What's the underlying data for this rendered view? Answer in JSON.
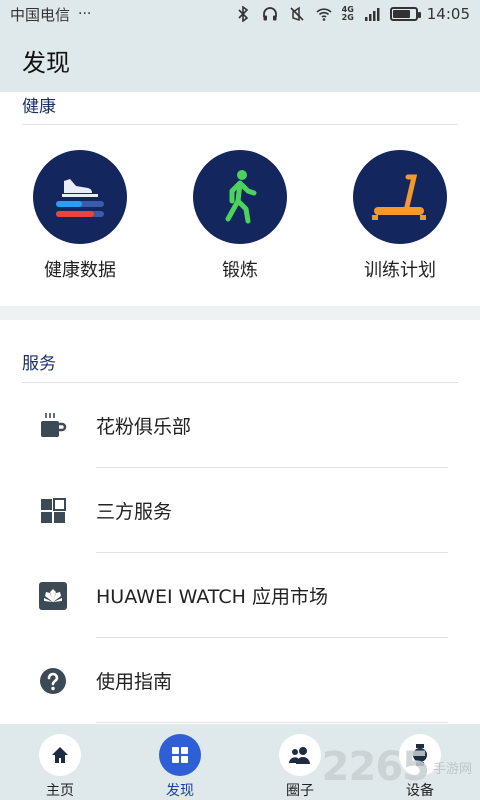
{
  "status_bar": {
    "carrier": "中国电信",
    "more": "···",
    "network_top": "4G",
    "network_bottom": "2G",
    "time": "14:05",
    "battery_level": 0.7
  },
  "app_bar": {
    "title": "发现"
  },
  "health": {
    "title": "健康",
    "items": [
      {
        "label": "健康数据",
        "icon": "shoe-progress-icon"
      },
      {
        "label": "锻炼",
        "icon": "walking-person-icon"
      },
      {
        "label": "训练计划",
        "icon": "treadmill-icon"
      }
    ]
  },
  "services": {
    "title": "服务",
    "items": [
      {
        "label": "花粉俱乐部",
        "icon": "coffee-cup-icon"
      },
      {
        "label": "三方服务",
        "icon": "grid-squares-icon"
      },
      {
        "label": "HUAWEI WATCH 应用市场",
        "icon": "huawei-logo-icon"
      },
      {
        "label": "使用指南",
        "icon": "question-icon"
      }
    ]
  },
  "tabs": [
    {
      "label": "主页",
      "icon": "home-icon",
      "active": false
    },
    {
      "label": "发现",
      "icon": "discover-grid-icon",
      "active": true
    },
    {
      "label": "圈子",
      "icon": "people-icon",
      "active": false
    },
    {
      "label": "设备",
      "icon": "watch-icon",
      "active": false
    }
  ],
  "watermark": {
    "number": "2265",
    "text": "手游网"
  },
  "colors": {
    "header_bg": "#dfe8ea",
    "circle_bg": "#14265e",
    "section_title": "#1b2f6b",
    "tab_active": "#2f5fd6"
  }
}
